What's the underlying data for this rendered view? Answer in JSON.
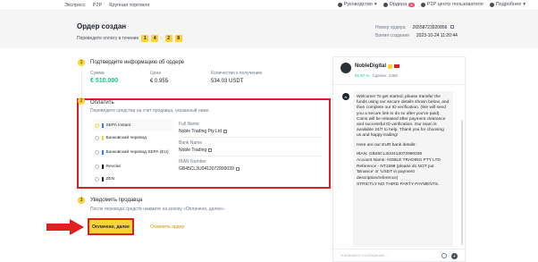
{
  "topbar": {
    "nav": [
      "Экспресс",
      "P2P",
      "Крупная торговля"
    ],
    "guide": "Руководство",
    "orders": "Ордера",
    "orders_count": "8",
    "p2p_center": "P2P центр пользователя",
    "more": "Подробнее"
  },
  "header": {
    "title": "Ордер создан",
    "transfer_text": "Переведите оплату в течение",
    "timer": [
      "1",
      "4",
      "2",
      "8"
    ],
    "order_number_label": "Номер ордера",
    "order_number": "26558723920856",
    "created_label": "Время создания",
    "created_time": "2023-10-24 11:20:44"
  },
  "step1": {
    "num": "1",
    "title": "Подтвердите информацию об ордере",
    "sum_label": "Сумма",
    "sum_value": "€ 510.000",
    "price_label": "Цена",
    "price_value": "€ 0.955",
    "qty_label": "Количество к получению",
    "qty_value": "534.03 USDT"
  },
  "step2": {
    "num": "2",
    "title": "Оплатить",
    "note": "Переведите средства на счет продавца, указанный ниже.",
    "methods": [
      "SEPA Instant",
      "Банковский перевод",
      "Банковский перевод SEPA (EU)",
      "Revolut",
      "ZEN"
    ],
    "method_colors": [
      "#2e7df6",
      "#fcd535",
      "#2e7df6",
      "#1e2329",
      "#1e2329"
    ],
    "full_name_label": "Full Name",
    "full_name": "Noble Trading Pty Ltd",
    "bank_name_label": "Bank Name",
    "bank_name": "Noble Trading",
    "iban_label": "IBAN Number",
    "iban": "GB45CL3U0413072990039"
  },
  "step3": {
    "num": "3",
    "title": "Уведомить продавца",
    "note": "После перевода средств нажмите на кнопку «Оплачено, далее».",
    "paid_button": "Оплачено, далее",
    "cancel_link": "Отменить ордер"
  },
  "chat": {
    "name": "NobleDigital",
    "rate": "91.67 %",
    "deals_label": "Сделки",
    "deals_count": "1466",
    "avatar_letter": "N",
    "message": [
      "Welcome! To get started, please transfer the funds using our secure details shown below, and then complete our ID verification. (We will send you a secure link to do so after you've paid). Coins will be released after payment clearance and successful ID verification. Our team is available 24/7 to help. Thank you for choosing us and happy trading!",
      "Here are our EUR bank details:",
      "IBAN: GB45CL3U0413072990039",
      "Account Name: NOBLE TRADING PTY LTD",
      "Reference - NT1598 (please do NOT put 'Binance' or 'USDT in payment description/reference)",
      "STRICTLY NO THIRD PARTY PAYMENTS."
    ],
    "input_placeholder": "Напишите сообщение..."
  },
  "colors": {
    "accent": "#fcd535",
    "highlight": "#d92027",
    "link": "#c99400"
  }
}
